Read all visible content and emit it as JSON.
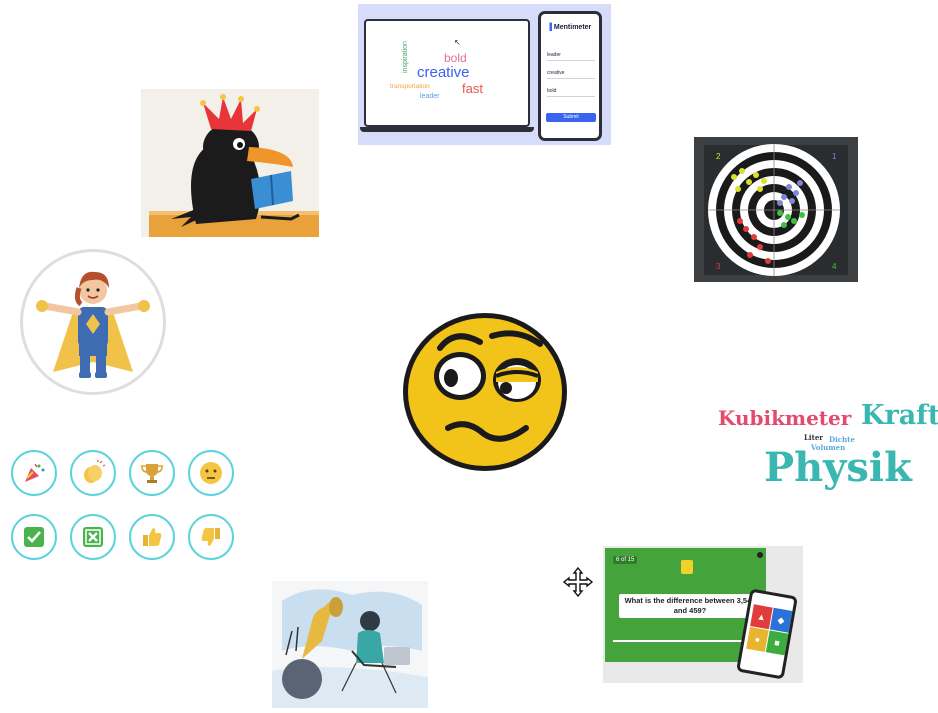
{
  "mentimeter": {
    "brand": "Mentimeter",
    "words": [
      "bold",
      "creative",
      "fast",
      "inspiration",
      "transportation",
      "leader"
    ],
    "responses": [
      "leader",
      "creative",
      "bold"
    ],
    "submit_label": "Submit",
    "colors": {
      "bold": "#e2729a",
      "creative": "#3a63f0",
      "fast": "#e4574f",
      "inspiration": "#3ba860",
      "transportation": "#f0a63a",
      "leader": "#5aa0e6"
    }
  },
  "target_board": {
    "corner_labels": [
      "2",
      "1",
      "3",
      "4"
    ]
  },
  "reaction_icons": [
    {
      "name": "party-popper-icon",
      "color": "#e04f5f"
    },
    {
      "name": "clapping-hands-icon",
      "color": "#f4c542"
    },
    {
      "name": "trophy-icon",
      "color": "#d9a23a"
    },
    {
      "name": "neutral-face-icon",
      "color": "#f4c542"
    },
    {
      "name": "check-mark-icon",
      "color": "#4bb34b"
    },
    {
      "name": "cross-mark-icon",
      "color": "#4bb34b"
    },
    {
      "name": "thumbs-up-icon",
      "color": "#f4c542"
    },
    {
      "name": "thumbs-down-icon",
      "color": "#f4c542"
    }
  ],
  "word_cloud": {
    "words": [
      {
        "text": "Kubikmeter",
        "color": "#e34b6e"
      },
      {
        "text": "Kraft",
        "color": "#3ab7b1"
      },
      {
        "text": "Liter",
        "color": "#333333"
      },
      {
        "text": "Dichte",
        "color": "#5aa7d8"
      },
      {
        "text": "Volumen",
        "color": "#5aa7d8"
      },
      {
        "text": "Physik",
        "color": "#3ab7b1"
      }
    ]
  },
  "quiz": {
    "progress": "6 of 15",
    "question": "What is the difference between 3,548 and 459?"
  }
}
